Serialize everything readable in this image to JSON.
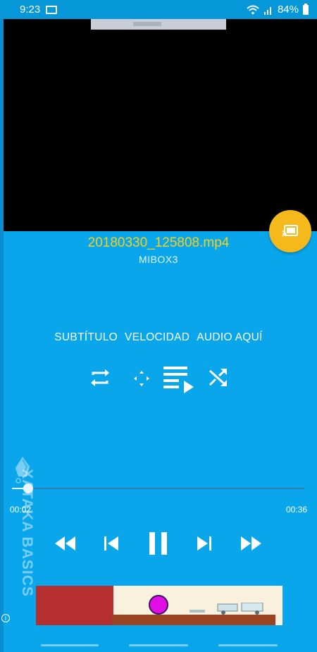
{
  "status_bar": {
    "time": "9:23",
    "battery": "84%",
    "icons": [
      "cast-status-icon",
      "wifi-icon",
      "signal-icon",
      "battery-icon"
    ]
  },
  "media": {
    "filename": "20180330_125808.mp4",
    "device": "MIBOX3"
  },
  "options": {
    "subtitle": "SUBTÍTULO",
    "speed": "VELOCIDAD",
    "audio": "AUDIO AQUÍ"
  },
  "playback_modes": [
    "repeat-icon",
    "fit-screen-icon",
    "queue-play-icon",
    "shuffle-icon"
  ],
  "progress": {
    "current": "00:02",
    "total": "00:36",
    "fraction": 0.055
  },
  "transport": [
    "rewind-icon",
    "skip-previous-icon",
    "pause-icon",
    "skip-next-icon",
    "fast-forward-icon"
  ],
  "watermark": {
    "text": "XATAKA BASICS"
  },
  "colors": {
    "background": "#0aa6ec",
    "accent_yellow": "#f5b91b",
    "filename_color": "#f6d11c"
  }
}
